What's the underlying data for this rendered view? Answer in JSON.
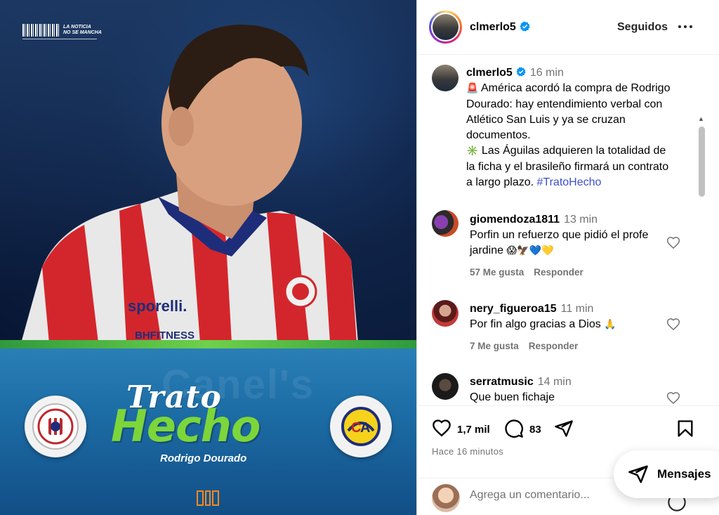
{
  "post": {
    "brand_top": "LA NOTICIA",
    "brand_bottom": "NO SE MANCHA",
    "title_small": "Trato",
    "title_big": "Hecho",
    "player_name": "Rodrigo Dourado",
    "watermark": "Canel's",
    "jersey_sponsor": "sporelli.",
    "jersey_sponsor2": "BHFITNESS"
  },
  "header": {
    "username": "clmerlo5",
    "follow_label": "Seguidos",
    "more_icon": "more-horizontal-icon"
  },
  "caption": {
    "username": "clmerlo5",
    "time": "16 min",
    "line1_emoji": "🚨",
    "line1": "América acordó la compra de Rodrigo Dourado: hay entendimiento verbal con Atlético San Luis y ya se cruzan documentos.",
    "line2_emoji": "✳️",
    "line2": "Las Águilas adquieren la totalidad de la ficha y el brasileño firmará un contrato a largo plazo.",
    "hashtag": "#TratoHecho"
  },
  "comments": [
    {
      "username": "giomendoza1811",
      "time": "13 min",
      "text": "Porfin un refuerzo que pidió el profe jardine",
      "emojis": "😱🦅💙💛",
      "likes": "57 Me gusta",
      "reply": "Responder"
    },
    {
      "username": "nery_figueroa15",
      "time": "11 min",
      "text": "Por fin algo gracias a Dios",
      "emojis": "🙏",
      "likes": "7 Me gusta",
      "reply": "Responder"
    },
    {
      "username": "serratmusic",
      "time": "14 min",
      "text": "Que buen fichaje",
      "emojis": "",
      "likes": "",
      "reply": ""
    }
  ],
  "actions": {
    "likes_count": "1,7 mil",
    "comments_count": "83",
    "timestamp": "Hace 16 minutos"
  },
  "comment_box": {
    "placeholder": "Agrega un comentario..."
  },
  "messages": {
    "label": "Mensajes"
  },
  "colors": {
    "verified_blue": "#0095f6",
    "hashtag": "#3e4ec9",
    "trato_green": "#7cd63a",
    "panel_blue": "#1d6ea7"
  }
}
